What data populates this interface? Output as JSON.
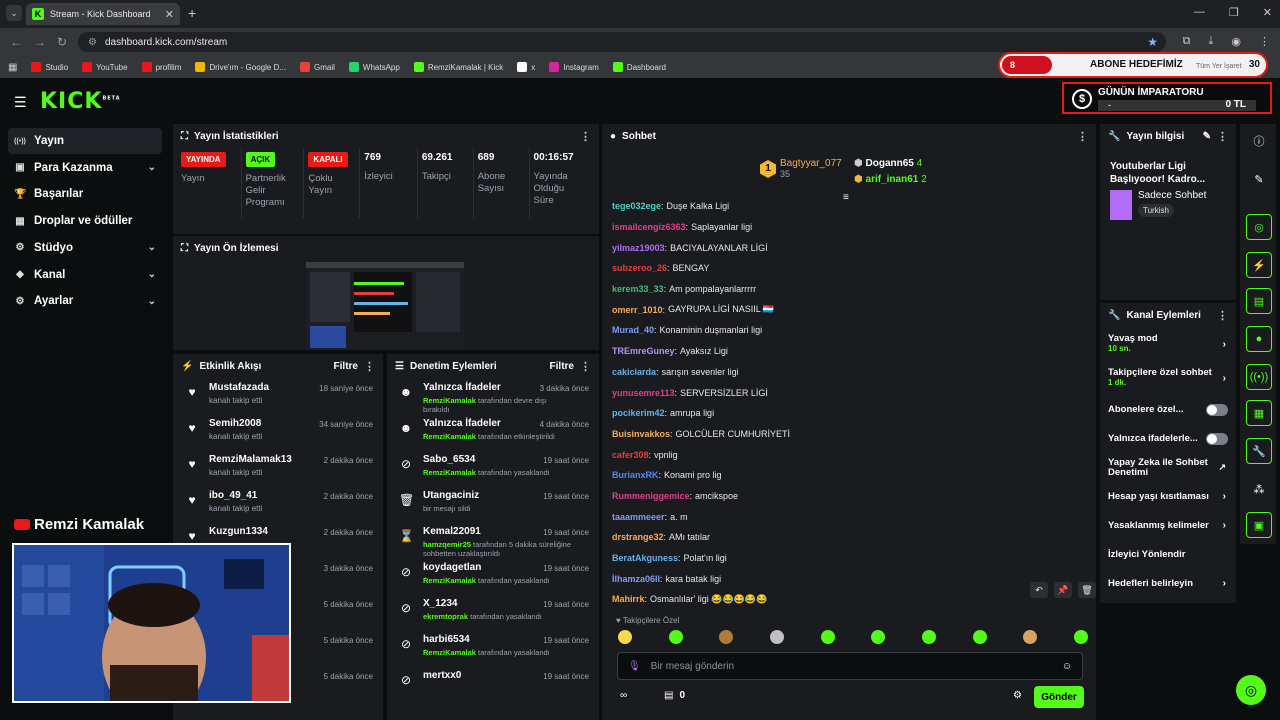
{
  "browser": {
    "tab_title": "Stream - Kick Dashboard",
    "url": "dashboard.kick.com/stream",
    "bookmarks": [
      {
        "label": "Studio",
        "color": "#e91916"
      },
      {
        "label": "YouTube",
        "color": "#e91916"
      },
      {
        "label": "profilim",
        "color": "#e91916"
      },
      {
        "label": "Drive'ım - Google D...",
        "color": "#f4b400"
      },
      {
        "label": "Gmail",
        "color": "#ea4335"
      },
      {
        "label": "WhatsApp",
        "color": "#25d366"
      },
      {
        "label": "RemziKamalak | Kick",
        "color": "#53fc18"
      },
      {
        "label": "x",
        "color": "#ffffff"
      },
      {
        "label": "Instagram",
        "color": "#d6249f"
      },
      {
        "label": "Dashboard",
        "color": "#53fc18"
      }
    ]
  },
  "overlay": {
    "goal_title": "ABONE HEDEFİMİZ",
    "goal_current": "8",
    "goal_target": "30",
    "goal_hidden_text": "Tüm Yer İşaret",
    "emperor_title": "GÜNÜN İMPARATORU",
    "emperor_name": "-",
    "emperor_amount": "0 TL",
    "streamer_name": "Remzi Kamalak"
  },
  "brand": {
    "logo": "KICK",
    "beta": "BETA",
    "accent": "#53fc18"
  },
  "sidebar": [
    {
      "label": "Yayın",
      "icon": "broadcast-icon",
      "active": true,
      "chevron": false
    },
    {
      "label": "Para Kazanma",
      "icon": "money-icon",
      "active": false,
      "chevron": true
    },
    {
      "label": "Başarılar",
      "icon": "trophy-icon",
      "active": false,
      "chevron": false
    },
    {
      "label": "Droplar ve ödüller",
      "icon": "gift-icon",
      "active": false,
      "chevron": false
    },
    {
      "label": "Stüdyo",
      "icon": "studio-icon",
      "active": false,
      "chevron": true
    },
    {
      "label": "Kanal",
      "icon": "channel-icon",
      "active": false,
      "chevron": true
    },
    {
      "label": "Ayarlar",
      "icon": "gear-icon",
      "active": false,
      "chevron": true
    }
  ],
  "stats_panel": {
    "title": "Yayın İstatistikleri",
    "items": [
      {
        "badge": "YAYINDA",
        "badge_color": "red",
        "label": "Yayın"
      },
      {
        "badge": "AÇIK",
        "badge_color": "green",
        "label": "Partnerlik Gelir Programı"
      },
      {
        "badge": "KAPALI",
        "badge_color": "red",
        "label": "Çoklu Yayın"
      },
      {
        "value": "769",
        "label": "İzleyici"
      },
      {
        "value": "69.261",
        "label": "Takipçi"
      },
      {
        "value": "689",
        "label": "Abone Sayısı"
      },
      {
        "value": "00:16:57",
        "label": "Yayında Olduğu Süre"
      }
    ]
  },
  "preview_panel": {
    "title": "Yayın Ön İzlemesi"
  },
  "activity": {
    "title": "Etkinlik Akışı",
    "filter": "Filtre",
    "items": [
      {
        "name": "Mustafazada",
        "sub": "kanalı takip etti",
        "time": "18 saniye önce"
      },
      {
        "name": "Semih2008",
        "sub": "kanalı takip etti",
        "time": "34 saniye önce"
      },
      {
        "name": "RemziMalamak13",
        "sub": "kanalı takip etti",
        "time": "2 dakika önce"
      },
      {
        "name": "ibo_49_41",
        "sub": "kanalı takip etti",
        "time": "2 dakika önce"
      },
      {
        "name": "Kuzgun1334",
        "sub": "",
        "time": "2 dakika önce"
      },
      {
        "name": "",
        "sub": "",
        "time": "3 dakika önce"
      },
      {
        "name": "",
        "sub": "",
        "time": "5 dakika önce"
      },
      {
        "name": "",
        "sub": "",
        "time": "5 dakika önce"
      },
      {
        "name": "",
        "sub": "",
        "time": "5 dakika önce"
      }
    ]
  },
  "moderation": {
    "title": "Denetim Eylemleri",
    "filter": "Filtre",
    "items": [
      {
        "icon": "face-icon",
        "name": "Yalnızca İfadeler",
        "actor": "RemziKamalak",
        "sub": "tarafından devre dışı bırakıldı",
        "time": "3 dakika önce"
      },
      {
        "icon": "face-icon",
        "name": "Yalnızca İfadeler",
        "actor": "RemziKamalak",
        "sub": "tarafından etkinleştirildi",
        "time": "4 dakika önce"
      },
      {
        "icon": "ban-icon",
        "name": "Sabo_6534",
        "actor": "RemziKamalak",
        "sub": "tarafından yasaklandı",
        "time": "19 saat önce"
      },
      {
        "icon": "trash-icon",
        "name": "Utangaciniz",
        "actor": "",
        "sub": "bir mesajı sildi",
        "time": "19 saat önce"
      },
      {
        "icon": "hourglass-icon",
        "name": "Kemal22091",
        "actor": "hamzqemir25",
        "sub": "tarafından 5 dakika süreliğine sohbetten uzaklaştırıldı",
        "time": "19 saat önce"
      },
      {
        "icon": "ban-icon",
        "name": "koydagetlan",
        "actor": "RemziKamalak",
        "sub": "tarafından yasaklandı",
        "time": "19 saat önce"
      },
      {
        "icon": "ban-icon",
        "name": "X_1234",
        "actor": "ekremtoprak",
        "sub": "tarafından yasaklandı",
        "time": "19 saat önce"
      },
      {
        "icon": "ban-icon",
        "name": "harbi6534",
        "actor": "RemziKamalak",
        "sub": "tarafından yasaklandı",
        "time": "19 saat önce"
      },
      {
        "icon": "ban-icon",
        "name": "mertxx0",
        "actor": "",
        "sub": "",
        "time": "19 saat önce"
      }
    ]
  },
  "chat": {
    "title": "Sohbet",
    "pinned": [
      {
        "name": "Bagtyyar_077",
        "count": "35",
        "rank": "1"
      },
      {
        "name": "Dogann65",
        "count": "4"
      },
      {
        "name": "arif_inan61",
        "count": "2"
      }
    ],
    "messages": [
      {
        "user": "tege032ege",
        "color": "#4fd1c5",
        "text": "Duşe Kalka Ligi"
      },
      {
        "user": "ismailcengiz6363",
        "color": "#e53e8d",
        "text": "Saplayanlar ligi"
      },
      {
        "user": "yilmaz19003",
        "color": "#b36cf5",
        "text": "BACIYALAYANLAR LİGİ"
      },
      {
        "user": "subzeroo_26",
        "color": "#e53e3e",
        "text": "BENGAY"
      },
      {
        "user": "kerem33_33",
        "color": "#48bb78",
        "text": "Am pompalayanlarrrrr"
      },
      {
        "user": "omerr_1010",
        "color": "#f6ad55",
        "text": "GAYRUPA LİGİ NASIIL 🇱🇺"
      },
      {
        "user": "Murad_40",
        "color": "#7f9cf5",
        "text": "Konaminin duşmanlari ligi"
      },
      {
        "user": "TREmreGuney",
        "color": "#b794f4",
        "text": "Ayaksız Ligi"
      },
      {
        "user": "cakiciarda",
        "color": "#63b3ed",
        "text": "sarışın sevenler ligi"
      },
      {
        "user": "yunusemre113",
        "color": "#e53e8d",
        "text": "SERVERSİZLER LİGİ"
      },
      {
        "user": "pocikerim42",
        "color": "#63b3ed",
        "text": "amrupa ligi"
      },
      {
        "user": "Buisinvakkos",
        "color": "#f6ad55",
        "text": "GOLCÜLER CUMHURİYETİ"
      },
      {
        "user": "cafer308",
        "color": "#e53e3e",
        "text": "vpnlig"
      },
      {
        "user": "BurianxRK",
        "color": "#4c8bf5",
        "text": "Konami pro lig"
      },
      {
        "user": "Rummeniggemice",
        "color": "#e53e8d",
        "text": "amcikspoe"
      },
      {
        "user": "taaammeeer",
        "color": "#7f9cf5",
        "text": "a. m"
      },
      {
        "user": "drstrange32",
        "color": "#f6ad55",
        "text": "AMı tatılar"
      },
      {
        "user": "BeratAkguness",
        "color": "#63b3ed",
        "text": "Polat'ın ligi"
      },
      {
        "user": "İlhamza06ll",
        "color": "#7f9cf5",
        "text": "kara batak ligi"
      },
      {
        "user": "Mahirrk",
        "color": "#f6ad55",
        "text": "Osmanlılar' ligi 😂😂😂😂😂"
      }
    ],
    "followers_only_label": "Takipçilere Özel",
    "input_placeholder": "Bir mesaj gönderin",
    "point_count": "0",
    "send_label": "Gönder"
  },
  "stream_info": {
    "title": "Yayın bilgisi",
    "stream_title": "Youtuberlar Ligi Başlıyooor! Kadro...",
    "category": "Sadece Sohbet",
    "language": "Turkish"
  },
  "channel_actions": {
    "title": "Kanal Eylemleri",
    "items": [
      {
        "label": "Yavaş mod",
        "sub": "10 sn.",
        "control": "chevron"
      },
      {
        "label": "Takipçilere özel sohbet",
        "sub": "1 dk.",
        "control": "chevron"
      },
      {
        "label": "Abonelere özel...",
        "sub": "",
        "control": "toggle"
      },
      {
        "label": "Yalnızca ifadelerle...",
        "sub": "",
        "control": "toggle"
      },
      {
        "label": "Yapay Zeka ile Sohbet Denetimi",
        "sub": "",
        "control": "external"
      },
      {
        "label": "Hesap yaşı kısıtlaması",
        "sub": "",
        "control": "chevron"
      },
      {
        "label": "Yasaklanmış kelimeler",
        "sub": "",
        "control": "chevron"
      },
      {
        "label": "İzleyici Yönlendir",
        "sub": "",
        "control": "none"
      },
      {
        "label": "Hedefleri belirleyin",
        "sub": "",
        "control": "chevron"
      }
    ]
  }
}
